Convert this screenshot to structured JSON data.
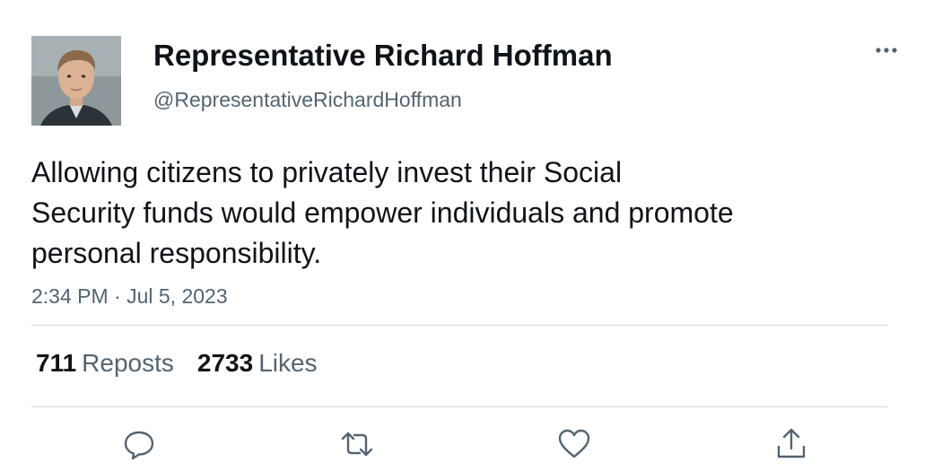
{
  "author": {
    "display_name": "Representative Richard Hoffman",
    "handle": "@RepresentativeRichardHoffman"
  },
  "tweet": {
    "text_lines": [
      "Allowing citizens to privately invest their Social",
      "Security funds would empower individuals and promote",
      "personal responsibility."
    ],
    "timestamp": "2:34 PM · Jul 5, 2023"
  },
  "stats": {
    "reposts_count": "711",
    "reposts_label": "Reposts",
    "likes_count": "2733",
    "likes_label": "Likes"
  },
  "icons": {
    "more": "more-dots-icon",
    "reply": "reply-icon",
    "repost": "repost-icon",
    "like": "heart-icon",
    "share": "share-icon"
  },
  "colors": {
    "text": "#0f1419",
    "secondary": "#536471",
    "divider": "#cfd9de"
  }
}
